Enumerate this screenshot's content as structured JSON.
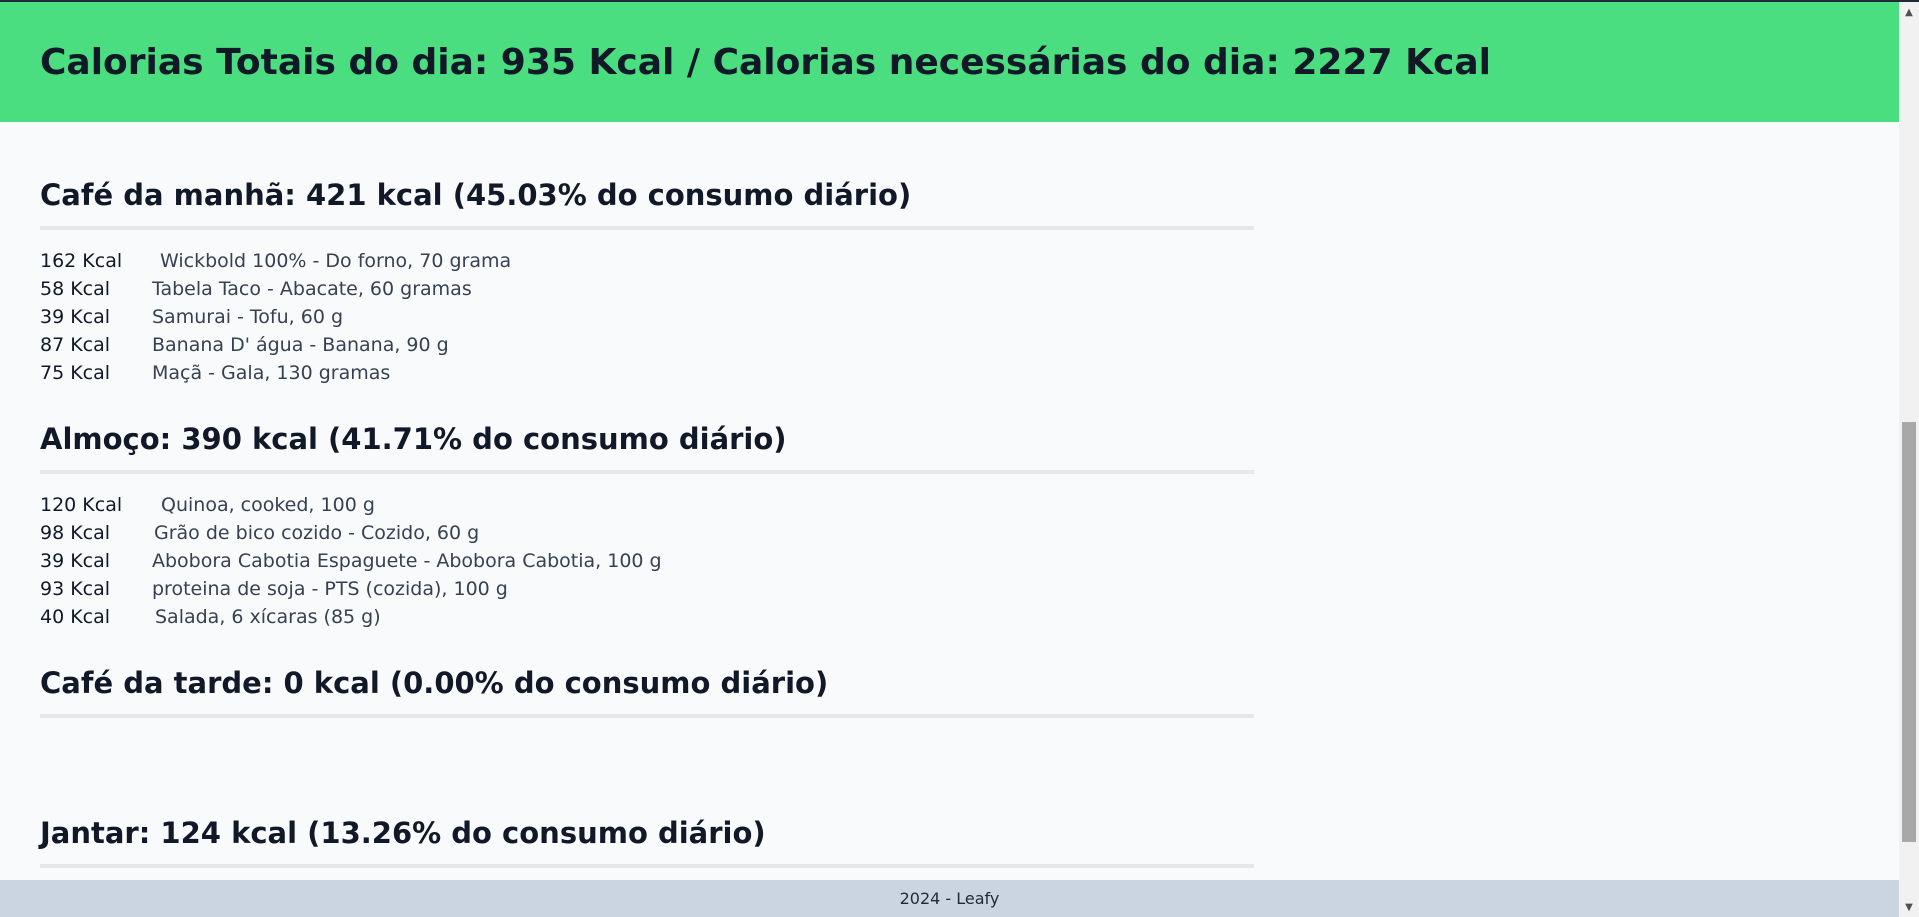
{
  "header": {
    "title": "Calorias Totais do dia: 935 Kcal / Calorias necessárias do dia: 2227 Kcal"
  },
  "meals": [
    {
      "title": "Café da manhã: 421 kcal (45.03% do consumo diário)",
      "items": [
        {
          "kcal": "162 Kcal",
          "desc": "Wickbold 100% - Do forno, 70 grama"
        },
        {
          "kcal": "58 Kcal",
          "desc": "Tabela Taco - Abacate, 60 gramas"
        },
        {
          "kcal": "39 Kcal",
          "desc": "Samurai - Tofu, 60 g"
        },
        {
          "kcal": "87 Kcal",
          "desc": "Banana D' água - Banana, 90 g"
        },
        {
          "kcal": "75 Kcal",
          "desc": "Maçã - Gala, 130 gramas"
        }
      ]
    },
    {
      "title": "Almoço: 390 kcal (41.71% do consumo diário)",
      "items": [
        {
          "kcal": "120 Kcal",
          "desc": "Quinoa, cooked, 100 g"
        },
        {
          "kcal": "98 Kcal",
          "desc": "Grão de bico cozido - Cozido, 60 g"
        },
        {
          "kcal": "39 Kcal",
          "desc": "Abobora Cabotia Espaguete - Abobora Cabotia, 100 g"
        },
        {
          "kcal": "93 Kcal",
          "desc": "proteina de soja - PTS (cozida), 100 g"
        },
        {
          "kcal": "40 Kcal",
          "desc": "Salada, 6 xícaras (85 g)"
        }
      ]
    },
    {
      "title": "Café da tarde: 0 kcal (0.00% do consumo diário)",
      "items": []
    },
    {
      "title": "Jantar: 124 kcal (13.26% do consumo diário)",
      "items": []
    }
  ],
  "footer": {
    "text": "2024 - Leafy"
  },
  "scrollbar": {
    "up_icon": "triangle-up",
    "down_icon": "triangle-down"
  }
}
